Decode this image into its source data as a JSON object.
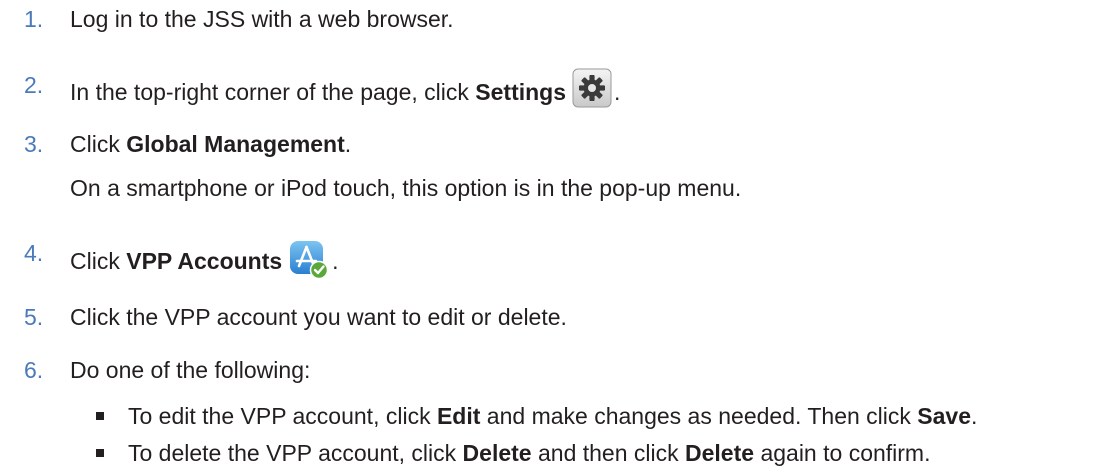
{
  "steps": [
    {
      "number": "1.",
      "text": "Log in to the JSS with a web browser."
    },
    {
      "number": "2.",
      "prefix": "In the top-right corner of the page, click ",
      "bold": "Settings",
      "icon": "gear-icon",
      "suffix": "."
    },
    {
      "number": "3.",
      "prefix": "Click ",
      "bold": "Global Management",
      "suffix": ".",
      "note": "On a smartphone or iPod touch, this option is in the pop-up menu."
    },
    {
      "number": "4.",
      "prefix": "Click ",
      "bold": "VPP Accounts",
      "icon": "vpp-accounts-icon",
      "suffix": "."
    },
    {
      "number": "5.",
      "text": "Click the VPP account you want to edit or delete."
    },
    {
      "number": "6.",
      "text": "Do one of the following:"
    }
  ],
  "bullets": [
    {
      "p1": "To edit the VPP account, click ",
      "b1": "Edit",
      "p2": " and make changes as needed. Then click ",
      "b2": "Save",
      "p3": "."
    },
    {
      "p1": "To delete the VPP account, click ",
      "b1": "Delete",
      "p2": " and then click ",
      "b2": "Delete",
      "p3": " again to confirm."
    }
  ]
}
